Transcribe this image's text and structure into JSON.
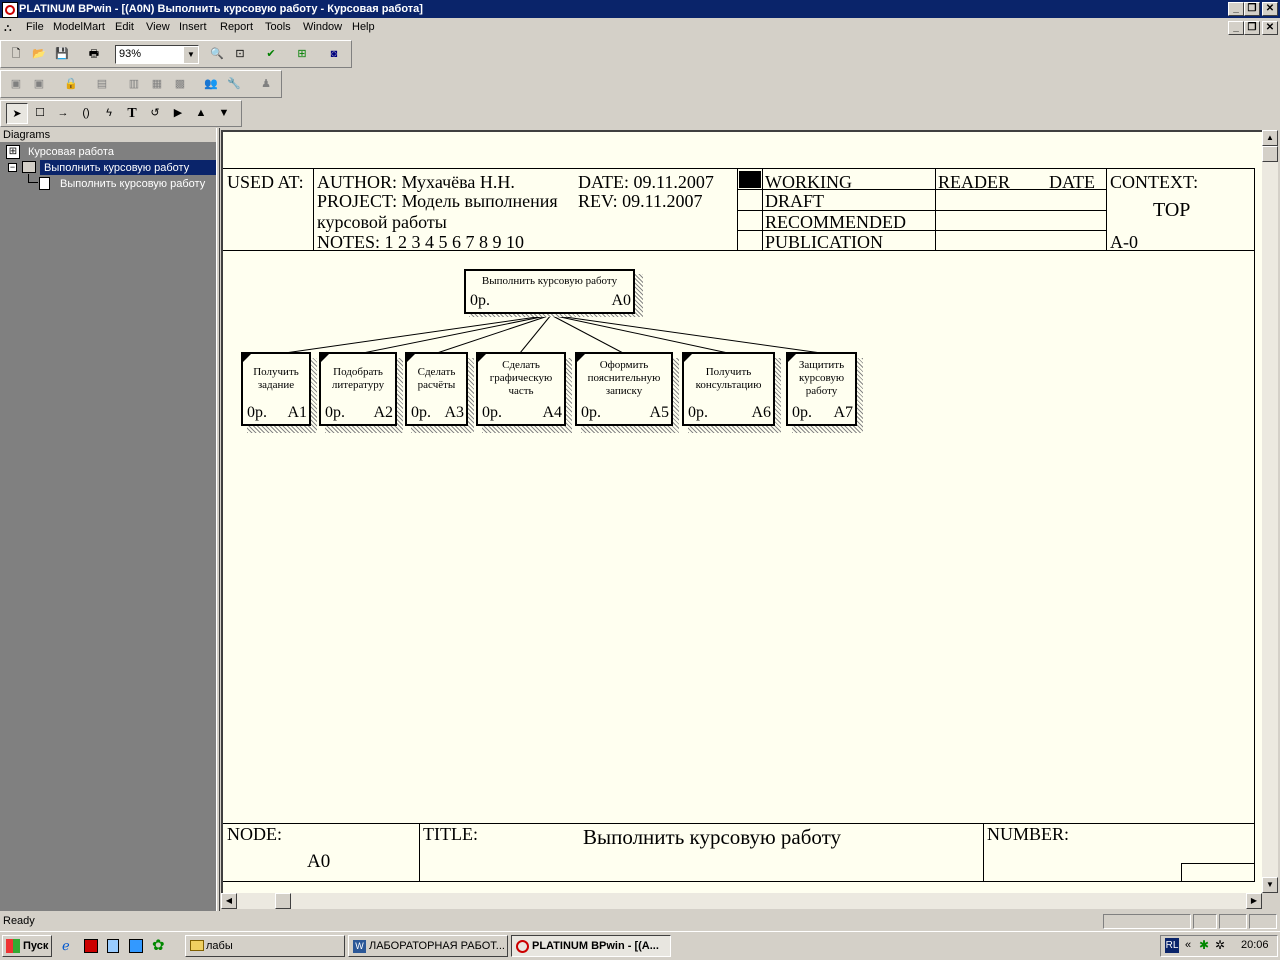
{
  "window": {
    "title": "PLATINUM BPwin - [(A0N) Выполнить курсовую работу - Курсовая работа]"
  },
  "menu": [
    "File",
    "ModelMart",
    "Edit",
    "View",
    "Insert",
    "Report",
    "Tools",
    "Window",
    "Help"
  ],
  "toolbar": {
    "zoom_value": "93%"
  },
  "tree": {
    "header": "Diagrams",
    "items": [
      {
        "label": "Курсовая работа",
        "level": 0,
        "selected": false
      },
      {
        "label": "Выполнить курсовую работу",
        "level": 1,
        "selected": true
      },
      {
        "label": "Выполнить курсовую работу",
        "level": 2,
        "selected": false
      }
    ]
  },
  "diagram": {
    "header": {
      "used_at": "USED AT:",
      "author": "AUTHOR:  Мухачёва Н.Н.",
      "date": "DATE: 09.11.2007",
      "project": "PROJECT:  Модель выполнения",
      "project_cont": "курсовой работы",
      "rev": "REV:    09.11.2007",
      "notes": "NOTES:  1  2  3  4  5  6  7  8  9  10",
      "status": [
        "WORKING",
        "DRAFT",
        "RECOMMENDED",
        "PUBLICATION"
      ],
      "reader": "READER",
      "reader_date": "DATE",
      "context": "CONTEXT:",
      "context_value": "TOP",
      "context_node": "A-0"
    },
    "parent": {
      "title": "Выполнить курсовую работу",
      "cost": "0р.",
      "number": "A0"
    },
    "children": [
      {
        "title": "Получить задание",
        "cost": "0р.",
        "number": "A1"
      },
      {
        "title": "Подобрать литературу",
        "cost": "0р.",
        "number": "A2"
      },
      {
        "title": "Сделать расчёты",
        "cost": "0р.",
        "number": "A3"
      },
      {
        "title": "Сделать графическую часть",
        "cost": "0р.",
        "number": "A4"
      },
      {
        "title": "Оформить пояснительную записку",
        "cost": "0р.",
        "number": "A5"
      },
      {
        "title": "Получить консультацию",
        "cost": "0р.",
        "number": "A6"
      },
      {
        "title": "Защитить курсовую работу",
        "cost": "0р.",
        "number": "A7"
      }
    ],
    "footer": {
      "node_label": "NODE:",
      "node_value": "A0",
      "title_label": "TITLE:",
      "title_value": "Выполнить курсовую работу",
      "number_label": "NUMBER:"
    }
  },
  "status_bar": {
    "text": "Ready"
  },
  "taskbar": {
    "start": "Пуск",
    "buttons": [
      {
        "label": "лабы",
        "active": false
      },
      {
        "label": "ЛАБОРАТОРНАЯ РАБОТ...",
        "active": false
      },
      {
        "label": "PLATINUM BPwin - [(A...",
        "active": true
      }
    ],
    "lang": "RL",
    "clock": "20:06"
  }
}
